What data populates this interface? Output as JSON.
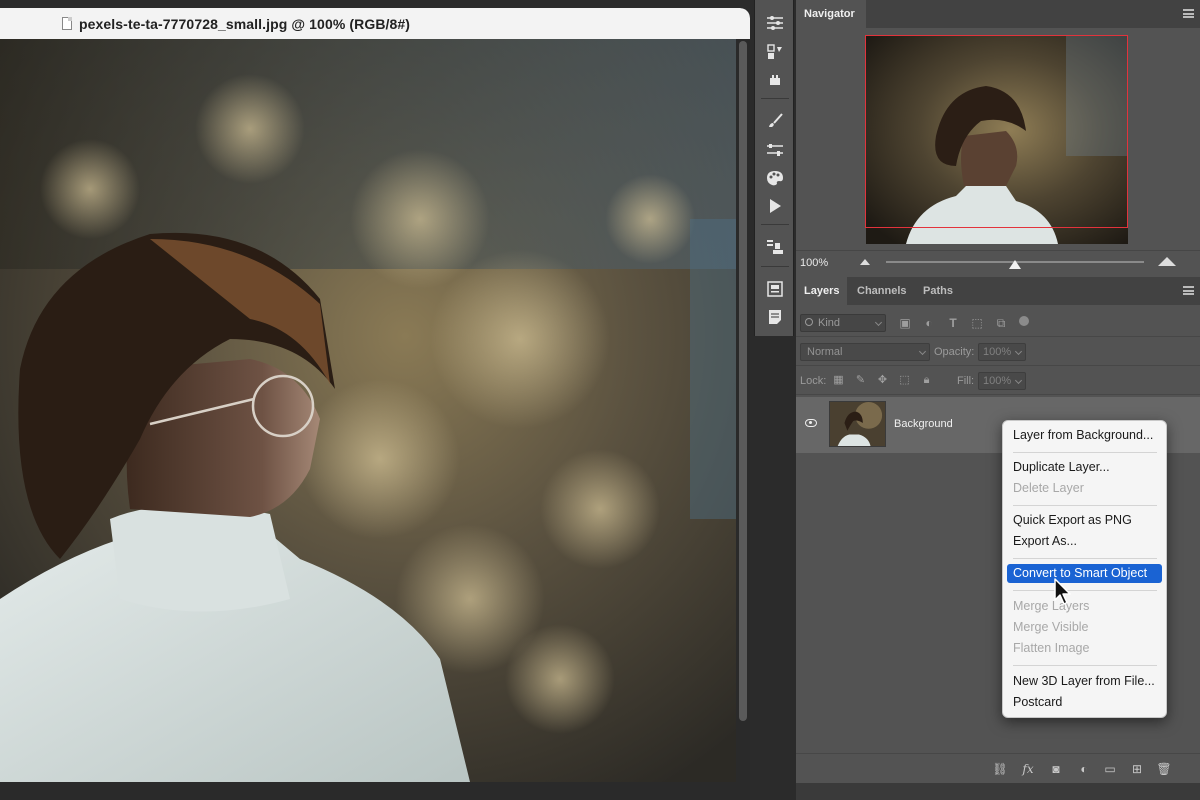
{
  "document": {
    "title": "pexels-te-ta-7770728_small.jpg @ 100% (RGB/8#)"
  },
  "tools": {
    "icons": [
      "sliders-icon",
      "adjustment-icon",
      "stamp-icon",
      "brush-icon",
      "brush-settings-icon",
      "palette-icon",
      "play-icon",
      "clone-source-icon",
      "glyphs-icon",
      "notes-icon"
    ]
  },
  "navigator": {
    "tab": "Navigator",
    "zoom": "100%",
    "viewbox_color": "#e2333c"
  },
  "layers_panel": {
    "tabs": [
      "Layers",
      "Channels",
      "Paths"
    ],
    "filter_placeholder": "Kind",
    "blend_mode": "Normal",
    "opacity_label": "Opacity:",
    "opacity_value": "100%",
    "lock_label": "Lock:",
    "fill_label": "Fill:",
    "fill_value": "100%",
    "layer": {
      "name": "Background",
      "visible": true
    }
  },
  "context_menu": {
    "items": [
      {
        "label": "Layer from Background...",
        "enabled": true
      },
      {
        "label": "Duplicate Layer...",
        "enabled": true
      },
      {
        "label": "Delete Layer",
        "enabled": false
      },
      {
        "label": "Quick Export as PNG",
        "enabled": true
      },
      {
        "label": "Export As...",
        "enabled": true
      },
      {
        "label": "Convert to Smart Object",
        "enabled": true,
        "highlighted": true
      },
      {
        "label": "Merge Layers",
        "enabled": false
      },
      {
        "label": "Merge Visible",
        "enabled": false
      },
      {
        "label": "Flatten Image",
        "enabled": false
      },
      {
        "label": "New 3D Layer from File...",
        "enabled": true
      },
      {
        "label": "Postcard",
        "enabled": true
      }
    ],
    "highlight_color": "#1a63d3"
  },
  "bottom_bar": {
    "icons": [
      "link-layers-icon",
      "fx-icon",
      "layer-mask-icon",
      "adjustment-layer-icon",
      "new-group-icon",
      "new-layer-icon",
      "trash-icon"
    ]
  }
}
